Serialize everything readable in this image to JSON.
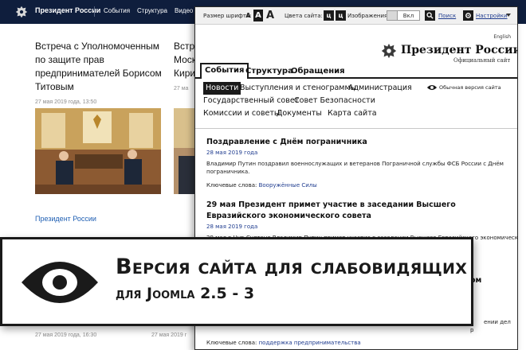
{
  "background_site": {
    "brand": "Президент России",
    "nav": [
      "События",
      "Структура",
      "Видео и ф"
    ],
    "card1": {
      "title": "Встреча с Уполномоченным по защите прав предпринимателей Борисом Титовым",
      "date": "27 мая 2019 года, 13:50"
    },
    "card2": {
      "title_lines": [
        "Встре",
        "Моск",
        "Кири"
      ],
      "date": "27 ма"
    },
    "section_link": "Президент России",
    "bottom_date_left": "27 мая 2019 года, 16:30",
    "bottom_date_right": "27 мая 2019 г"
  },
  "accessible_site": {
    "toolbar": {
      "font_size_label": "Размер шрифта:",
      "font_a_small": "A",
      "font_a_medium": "A",
      "font_a_large": "A",
      "site_colors_label": "Цвета сайта:",
      "color_c1": "ц",
      "color_c2": "ц",
      "images_label": "Изображения",
      "images_toggle": "Вкл",
      "search_link": "Поиск",
      "settings_link": "Настройки"
    },
    "header": {
      "lang": "English",
      "brand": "Президент России",
      "subtitle": "Официальный сайт"
    },
    "tabs": [
      "События",
      "Структура",
      "Обращения"
    ],
    "subnav_row1": [
      "Новости",
      "Выступления и стенограммы",
      "Администрация"
    ],
    "subnav_row2": [
      "Государственный совет",
      "Совет Безопасности"
    ],
    "subnav_row3": [
      "Комиссии и советы",
      "Документы",
      "Карта сайта"
    ],
    "regular_version_link": "Обычная версия сайта",
    "articles": [
      {
        "title": "Поздравление с Днём пограничника",
        "date": "28 мая 2019 года",
        "text": "Владимир Путин поздравил военнослужащих и ветеранов Пограничной службы ФСБ России с Днём пограничника.",
        "keywords_label": "Ключевые слова:",
        "keywords": "Вооружённые Силы"
      },
      {
        "title": "29 мая Президент примет участие в заседании Высшего Евразийского экономического совета",
        "date": "28 мая 2019 года",
        "text": "29 мая в Нур-Султане Владимир Путин примет участие в заседании Высшего Евразийского экономического",
        "keywords_label": "",
        "keywords": ""
      }
    ],
    "partial_right_1": "ом",
    "partial_right_2": "ении дел",
    "partial_right_3": "р",
    "partial_keywords_label": "Ключевые слова:",
    "partial_keywords": "поддержка предпринимательства"
  },
  "banner": {
    "title": "Версия сайта для слабовидящих",
    "subtitle": "для Joomla 2.5 - 3"
  },
  "colors": {
    "dark_navy": "#0f1e3d",
    "link_blue": "#1f3c8f",
    "ink": "#1a1a1a"
  }
}
